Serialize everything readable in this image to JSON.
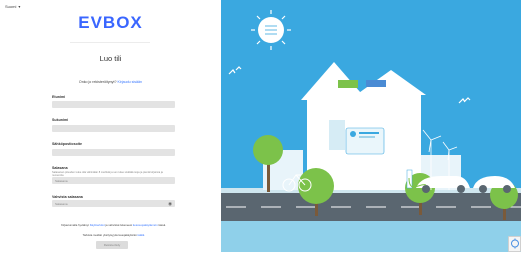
{
  "language": {
    "label": "Suomi"
  },
  "brand": {
    "logo_text": "EVBOX"
  },
  "page": {
    "title": "Luo tili",
    "have_account_text": "Onko jo rekisteröitynyt?",
    "login_link": "Kirjaudu sisään"
  },
  "form": {
    "first_name_label": "Etunimi",
    "last_name_label": "Sukunimi",
    "email_label": "Sähköpostiosoite",
    "password_label": "Salasana",
    "password_hint": "Salasanan pituuden tulee olla vähintään 8 merkkiä ja sen tulee sisältää isoja ja pieniä kirjaimia ja numeroita",
    "password_placeholder": "Salasana",
    "confirm_label": "Vahvista salasana",
    "confirm_placeholder": "Salasana"
  },
  "footer": {
    "terms_prefix": "Kirjautumalla hyväksyt",
    "terms_link": "Käyttöehdot",
    "terms_middle": "ja vahvistat lukeneesi",
    "privacy_link": "tietosuojakäytännön",
    "terms_suffix": "tässä.",
    "privacy_text": "Tarkista meidän yksityisyydensuojakäytäntö",
    "privacy_link2": "täältä",
    "submit_label": "Rekisteröidy"
  },
  "colors": {
    "brand": "#3a66ff",
    "sky": "#3aa8e0",
    "link": "#3a78ff"
  },
  "icons": [
    "caret-down-icon",
    "eye-icon",
    "recaptcha-icon"
  ]
}
